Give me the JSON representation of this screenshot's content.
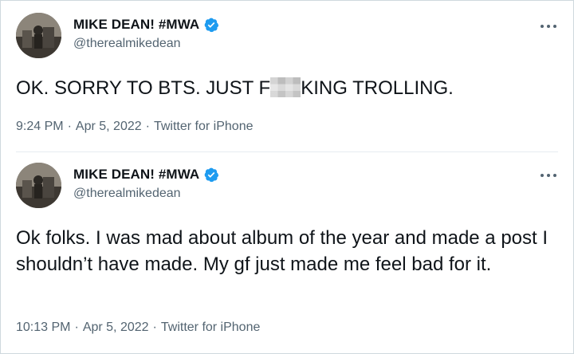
{
  "tweets": [
    {
      "display_name": "MIKE DEAN! #MWA",
      "handle": "@therealmikedean",
      "text_before": "OK. SORRY TO BTS. JUST F",
      "text_after": "KING TROLLING.",
      "time": "9:24 PM",
      "date": "Apr 5, 2022",
      "source": "Twitter for iPhone",
      "separator": "·"
    },
    {
      "display_name": "MIKE DEAN! #MWA",
      "handle": "@therealmikedean",
      "text": "Ok folks. I was mad about album of the year and made a post I shouldn’t have made. My gf just made me feel bad for it.",
      "time": "10:13 PM",
      "date": "Apr 5, 2022",
      "source": "Twitter for iPhone",
      "separator": "·"
    }
  ],
  "icons": {
    "verified": "verified-badge-icon",
    "more": "more-options-icon",
    "verified_color": "#1d9bf0"
  }
}
